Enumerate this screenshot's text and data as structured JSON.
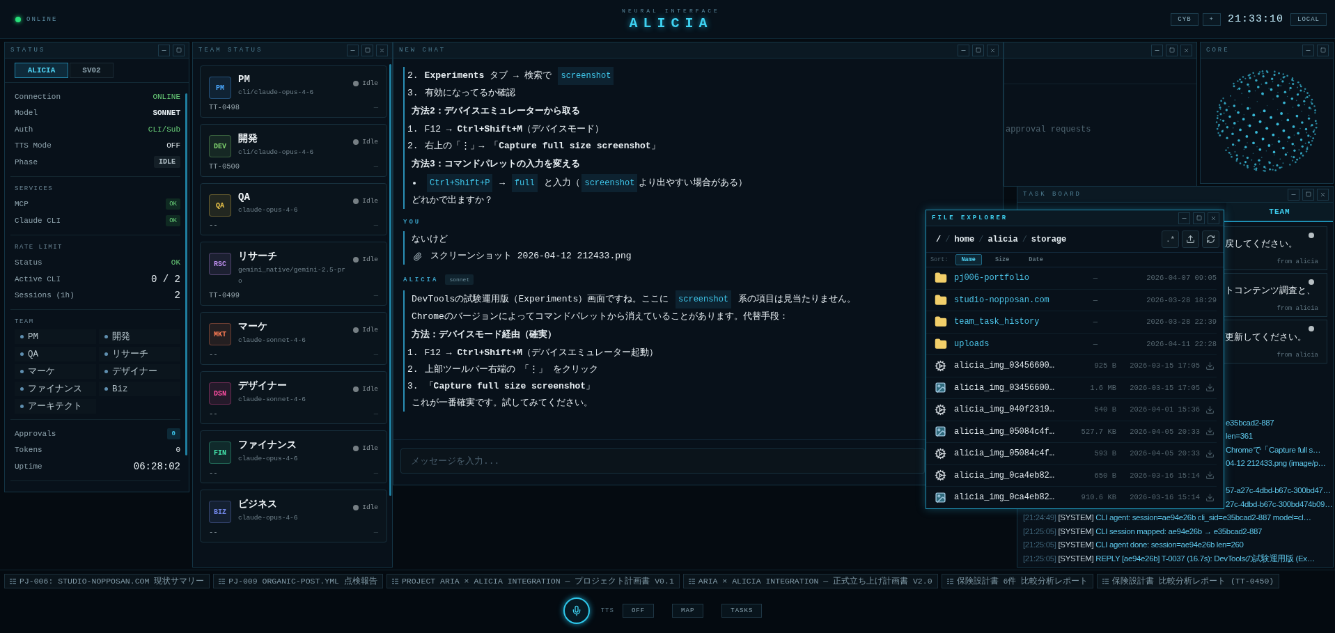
{
  "topbar": {
    "status": "ONLINE",
    "online": true,
    "subtitle": "NEURAL INTERFACE",
    "title": "ALICIA",
    "buttons": [
      "CYB",
      "+"
    ],
    "clock": "21:33:10",
    "mode": "LOCAL"
  },
  "status_panel": {
    "title": "STATUS",
    "tabs": [
      {
        "label": "ALICIA",
        "selected": true
      },
      {
        "label": "SV02",
        "selected": false
      }
    ],
    "sections": [
      {
        "kind": "rows",
        "rows": [
          {
            "label": "Connection",
            "value": "ONLINE",
            "kind": "ok"
          },
          {
            "label": "Model",
            "value": "SONNET",
            "kind": "strong"
          },
          {
            "label": "Auth",
            "value": "CLI/Sub",
            "kind": "ok"
          },
          {
            "label": "TTS Mode",
            "value": "OFF",
            "kind": "plain"
          },
          {
            "label": "Phase",
            "value": "IDLE",
            "kind": "badge"
          }
        ]
      },
      {
        "kind": "rows",
        "title": "SERVICES",
        "rows": [
          {
            "label": "MCP",
            "value": "OK",
            "kind": "pill"
          },
          {
            "label": "Claude CLI",
            "value": "OK",
            "kind": "pill"
          }
        ]
      },
      {
        "kind": "rows",
        "title": "RATE LIMIT",
        "rows": [
          {
            "label": "Status",
            "value": "OK",
            "kind": "ok"
          },
          {
            "label": "Active CLI",
            "value": "0 / 2",
            "kind": "big"
          },
          {
            "label": "Sessions (1h)",
            "value": "2",
            "kind": "big"
          }
        ]
      },
      {
        "kind": "members",
        "title": "TEAM",
        "members": [
          "PM",
          "開発",
          "QA",
          "リサーチ",
          "マーケ",
          "デザイナー",
          "ファイナンス",
          "Biz",
          "アーキテクト"
        ]
      },
      {
        "kind": "rows",
        "rows": [
          {
            "label": "Approvals",
            "value": "0",
            "kind": "count"
          },
          {
            "label": "Tokens",
            "value": "0",
            "kind": "plain"
          },
          {
            "label": "Uptime",
            "value": "06:28:02",
            "kind": "big"
          }
        ]
      }
    ]
  },
  "team_status": {
    "title": "TEAM STATUS",
    "members": [
      {
        "code": "PM",
        "name": "PM",
        "model": "cli/claude-opus-4-6",
        "status": "Idle",
        "task": "TT-0498",
        "trailing": "—",
        "color": "#4aa8ff"
      },
      {
        "code": "DEV",
        "name": "開発",
        "model": "cli/claude-opus-4-6",
        "status": "Idle",
        "task": "TT-0500",
        "trailing": "—",
        "color": "#7fd36e"
      },
      {
        "code": "QA",
        "name": "QA",
        "model": "claude-opus-4-6",
        "status": "Idle",
        "task": "--",
        "trailing": "—",
        "color": "#f0c84a"
      },
      {
        "code": "RSC",
        "name": "リサーチ",
        "model": "gemini_native/gemini-2.5-pro",
        "status": "Idle",
        "task": "TT-0499",
        "trailing": "—",
        "color": "#b98be8"
      },
      {
        "code": "MKT",
        "name": "マーケ",
        "model": "claude-sonnet-4-6",
        "status": "Idle",
        "task": "--",
        "trailing": "—",
        "color": "#ff7d55"
      },
      {
        "code": "DSN",
        "name": "デザイナー",
        "model": "claude-sonnet-4-6",
        "status": "Idle",
        "task": "--",
        "trailing": "—",
        "color": "#ff4fa3"
      },
      {
        "code": "FIN",
        "name": "ファイナンス",
        "model": "claude-opus-4-6",
        "status": "Idle",
        "task": "--",
        "trailing": "—",
        "color": "#45e6ad"
      },
      {
        "code": "BIZ",
        "name": "ビジネス",
        "model": "claude-opus-4-6",
        "status": "Idle",
        "task": "--",
        "trailing": "—",
        "color": "#7186e6"
      }
    ]
  },
  "chat": {
    "title": "NEW CHAT",
    "messages": [
      {
        "blocks": [
          {
            "kind": "ol",
            "number": "2.",
            "parts": [
              {
                "kind": "text",
                "text": "**Experiments** タブ → 検索で "
              },
              {
                "kind": "code",
                "text": "screenshot"
              }
            ]
          },
          {
            "kind": "ol",
            "number": "3.",
            "parts": [
              {
                "kind": "text",
                "text": "有効になってるか確認"
              }
            ]
          },
          {
            "kind": "heading",
            "parts": [
              {
                "kind": "text",
                "text": "方法2：デバイスエミュレーターから取る"
              }
            ]
          },
          {
            "kind": "ol",
            "number": "1.",
            "parts": [
              {
                "kind": "text",
                "text": "F12 → **Ctrl+Shift+M**（デバイスモード）"
              }
            ]
          },
          {
            "kind": "ol",
            "number": "2.",
            "parts": [
              {
                "kind": "text",
                "text": "右上の「⋮」→ 「**Capture full size screenshot**」"
              }
            ]
          },
          {
            "kind": "heading",
            "parts": [
              {
                "kind": "text",
                "text": "方法3：コマンドパレットの入力を変える"
              }
            ]
          },
          {
            "kind": "ul",
            "parts": [
              {
                "kind": "code",
                "text": "Ctrl+Shift+P"
              },
              {
                "kind": "text",
                "text": " → "
              },
              {
                "kind": "code",
                "text": "full"
              },
              {
                "kind": "text",
                "text": " と入力（"
              },
              {
                "kind": "code",
                "text": "screenshot"
              },
              {
                "kind": "text",
                "text": "より出やすい場合がある）"
              }
            ]
          },
          {
            "kind": "para",
            "parts": [
              {
                "kind": "text",
                "text": "どれかで出ますか？"
              }
            ]
          }
        ]
      },
      {
        "sender": "YOU",
        "blocks": [
          {
            "kind": "para",
            "parts": [
              {
                "kind": "text",
                "text": "ないけど"
              }
            ]
          },
          {
            "kind": "attachment",
            "parts": [
              {
                "kind": "text",
                "text": "スクリーンショット 2026-04-12 212433.png"
              }
            ]
          }
        ]
      },
      {
        "sender": "ALICIA",
        "badge": "sonnet",
        "blocks": [
          {
            "kind": "para",
            "parts": [
              {
                "kind": "text",
                "text": "DevToolsの試験運用版（Experiments）画面ですね。ここに "
              },
              {
                "kind": "code",
                "text": "screenshot"
              },
              {
                "kind": "text",
                "text": " 系の項目は見当たりません。"
              }
            ]
          },
          {
            "kind": "para",
            "parts": [
              {
                "kind": "text",
                "text": "Chromeのバージョンによってコマンドパレットから消えていることがあります。代替手段："
              }
            ]
          },
          {
            "kind": "heading",
            "parts": [
              {
                "kind": "text",
                "text": "方法：デバイスモード経由（確実）"
              }
            ]
          },
          {
            "kind": "ol",
            "number": "1.",
            "parts": [
              {
                "kind": "text",
                "text": "F12 → **Ctrl+Shift+M**（デバイスエミュレーター起動）"
              }
            ]
          },
          {
            "kind": "ol",
            "number": "2.",
            "parts": [
              {
                "kind": "text",
                "text": "上部ツールバー右端の 「⋮」 をクリック"
              }
            ]
          },
          {
            "kind": "ol",
            "number": "3.",
            "parts": [
              {
                "kind": "text",
                "text": "「**Capture full size screenshot**」"
              }
            ]
          },
          {
            "kind": "para",
            "parts": [
              {
                "kind": "text",
                "text": "これが一番確実です。試してみてください。"
              }
            ]
          }
        ]
      }
    ],
    "input": {
      "placeholder": "メッセージを入力..."
    }
  },
  "approvals_window": {
    "text": "approval requests"
  },
  "core": {
    "title": "CORE"
  },
  "task_board": {
    "title": "TASK BOARD",
    "tabs": [
      {
        "label": "TEAM",
        "selected": true
      }
    ],
    "cards": [
      {
        "text": "戻してください。",
        "from": "from alicia"
      },
      {
        "text": "トコンテンツ調査と、",
        "from": "from alicia"
      },
      {
        "text": "更新してください。",
        "from": "from alicia"
      }
    ],
    "log": [
      {
        "kind": "fragment",
        "text": "e35bcad2-887"
      },
      {
        "kind": "fragment",
        "text": "len=361"
      },
      {
        "kind": "fragment",
        "text": "Chromeで「Capture full s…"
      },
      {
        "kind": "fragment",
        "text": "04-12 212433.png (image/p…"
      },
      {
        "kind": "gap"
      },
      {
        "kind": "fragment",
        "text": "57-a27c-4dbd-b67c-300bd47…"
      },
      {
        "kind": "fragment",
        "text": "27c-4dbd-b67c-300bd474b09…"
      },
      {
        "kind": "line",
        "time": "[21:24:49]",
        "tag": "[SYSTEM]",
        "text": "CLI agent: session=ae94e26b cli_sid=e35bcad2-887 model=cl…"
      },
      {
        "kind": "line",
        "time": "[21:25:05]",
        "tag": "[SYSTEM]",
        "text": "CLI session mapped: ae94e26b → e35bcad2-887"
      },
      {
        "kind": "line",
        "time": "[21:25:05]",
        "tag": "[SYSTEM]",
        "text": "CLI agent done: session=ae94e26b len=260"
      },
      {
        "kind": "line",
        "time": "[21:25:05]",
        "tag": "[SYSTEM]",
        "text": "REPLY [ae94e26b] T-0037 (16.7s): DevToolsの試験運用版 (Ex…"
      }
    ]
  },
  "file_explorer": {
    "title": "FILE EXPLORER",
    "separator": "/",
    "crumbs": [
      "/",
      "home",
      "alicia",
      "storage"
    ],
    "regex_button": ".*",
    "sort": {
      "label": "Sort:",
      "options": [
        {
          "label": "Name",
          "selected": true
        },
        {
          "label": "Size",
          "selected": false
        },
        {
          "label": "Date",
          "selected": false
        }
      ]
    },
    "files": [
      {
        "kind": "folder",
        "name": "pj006-portfolio",
        "size": "—",
        "date": "2026-04-07 09:05"
      },
      {
        "kind": "folder",
        "name": "studio-nopposan.com",
        "size": "—",
        "date": "2026-03-28 18:29"
      },
      {
        "kind": "folder",
        "name": "team_task_history",
        "size": "—",
        "date": "2026-03-28 22:39"
      },
      {
        "kind": "folder",
        "name": "uploads",
        "size": "—",
        "date": "2026-04-11 22:28"
      },
      {
        "kind": "file",
        "name": "alicia_img_03456600…",
        "size": "925 B",
        "date": "2026-03-15 17:05"
      },
      {
        "kind": "image",
        "name": "alicia_img_03456600…",
        "size": "1.6 MB",
        "date": "2026-03-15 17:05"
      },
      {
        "kind": "file",
        "name": "alicia_img_040f2319…",
        "size": "540 B",
        "date": "2026-04-01 15:36"
      },
      {
        "kind": "image",
        "name": "alicia_img_05084c4f…",
        "size": "527.7 KB",
        "date": "2026-04-05 20:33"
      },
      {
        "kind": "file",
        "name": "alicia_img_05084c4f…",
        "size": "593 B",
        "date": "2026-04-05 20:33"
      },
      {
        "kind": "file",
        "name": "alicia_img_0ca4eb82…",
        "size": "650 B",
        "date": "2026-03-16 15:14"
      },
      {
        "kind": "image",
        "name": "alicia_img_0ca4eb82…",
        "size": "910.6 KB",
        "date": "2026-03-16 15:14"
      }
    ]
  },
  "doc_tabs": [
    "PJ-006: STUDIO-NOPPOSAN.COM 現状サマリー",
    "PJ-009 ORGANIC-POST.YML 点検報告",
    "PROJECT ARIA × ALICIA INTEGRATION — プロジェクト計画書 V0.1",
    "ARIA × ALICIA INTEGRATION — 正式立ち上げ計画書 V2.0",
    "保険設計書 6件 比較分析レポート",
    "保険設計書 比較分析レポート (TT-0450)"
  ],
  "dock": {
    "tts_label": "TTS",
    "buttons": [
      "OFF",
      "MAP",
      "TASKS"
    ]
  }
}
